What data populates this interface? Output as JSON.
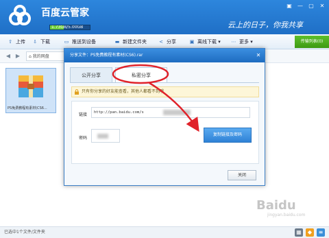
{
  "app": {
    "title": "百度云管家",
    "quota_text": "1.73GB/5.00GB",
    "quota_fraction": 0.35,
    "slogan": "云上的日子，你我共享",
    "brand_color": "#1f6fc6"
  },
  "window_controls": [
    "▣",
    "—",
    "▢",
    "✕"
  ],
  "toolbar": {
    "upload": "上传",
    "download": "下载",
    "push": "推送到设备",
    "new_folder": "新建文件夹",
    "share": "分享",
    "offline": "离线下载",
    "more": "更多",
    "transfer": "传输列表(0)"
  },
  "nav": {
    "breadcrumb": "我的网盘"
  },
  "files": [
    {
      "name": "PS免费教程有素材(CS6...",
      "icon": "zip-archive-icon"
    }
  ],
  "status": {
    "text": "已选中1个文件/文件夹"
  },
  "dialog": {
    "title": "分享文件：PS免费教程有素材(CS6).rar",
    "tab_public": "公开分享",
    "tab_private": "私密分享",
    "notice": "只有你分享的好友能查看，其他人都看不到哦",
    "link_label": "链接",
    "link_value": "http://pan.baidu.com/s",
    "password_label": "密码",
    "copy_button": "复制链接及密码",
    "close_button": "关闭"
  },
  "annotation_color": "#e0222a",
  "watermark": {
    "text": "Baidu",
    "sub": "jingyan.baidu.com"
  }
}
